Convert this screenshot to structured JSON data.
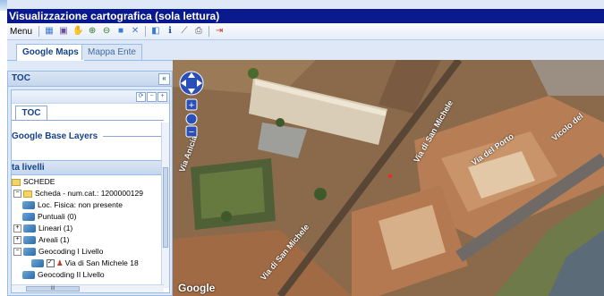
{
  "window": {
    "title": "Visualizzazione cartografica (sola lettura)"
  },
  "menubar": {
    "menu_label": "Menu"
  },
  "tabs": [
    {
      "label": "Google Maps"
    },
    {
      "label": "Mappa Ente"
    }
  ],
  "toc": {
    "title": "TOC",
    "collapse_icon": "«",
    "inner_tab": "TOC",
    "base_layers": "Google Base Layers",
    "lista_header": "ta livelli",
    "tree": [
      {
        "label": "SCHEDE"
      },
      {
        "label": "Scheda - num.cat.: 1200000129"
      },
      {
        "label": "Loc. Fisica: non presente"
      },
      {
        "label": "Puntuali (0)"
      },
      {
        "label": "Lineari (1)"
      },
      {
        "label": "Areali (1)"
      },
      {
        "label": "Geocoding I Livello"
      },
      {
        "label": "Via di San Michele 18"
      },
      {
        "label": "Geocoding II Livello"
      }
    ],
    "hscroll_label": "III"
  },
  "map": {
    "logo": "Google",
    "streets": [
      "Via di San Michele",
      "Via del Porto",
      "Vicolo del",
      "Via di San Michele",
      "Via Anicia"
    ]
  },
  "colors": {
    "title_bg": "#0a1a8c",
    "panel_bg": "#dfe8f6",
    "border": "#99bbe8"
  }
}
